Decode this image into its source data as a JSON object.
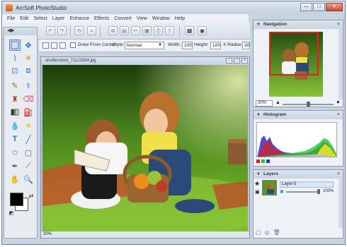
{
  "app": {
    "title": "ArcSoft PhotoStudio",
    "window_controls": {
      "minimize": "—",
      "maximize": "□",
      "close": "✕"
    }
  },
  "menu": [
    "File",
    "Edit",
    "Select",
    "Layer",
    "Enhance",
    "Effects",
    "Convert",
    "View",
    "Window",
    "Help"
  ],
  "options_bar": {
    "draw_from_center_label": "Draw From Center",
    "style_label": "Style:",
    "style_value": "Normal",
    "width_label": "Width:",
    "width_value": "100",
    "height_label": "Height:",
    "height_value": "100",
    "xradius_label": "X Radius:",
    "xradius_value": "30"
  },
  "document": {
    "filename": "shutterstock_71121934.jpg",
    "zoom_status": "20%"
  },
  "navigation": {
    "title": "Navigation",
    "zoom_value": "20%"
  },
  "histogram": {
    "title": "Histogram"
  },
  "layers": {
    "title": "Layers",
    "layer_name": "Layer-0",
    "opacity": "100%"
  },
  "colors": {
    "foreground": "#000000",
    "background": "#ffffff",
    "accent": "#5a7fb0"
  }
}
